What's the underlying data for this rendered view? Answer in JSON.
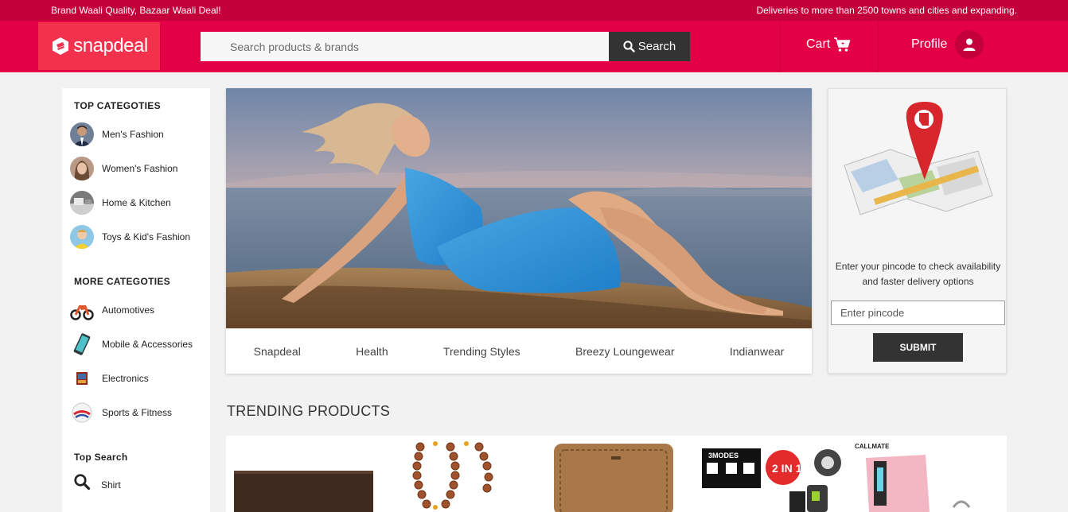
{
  "top_strip": {
    "left_text": "Brand Waali Quality, Bazaar Waali Deal!",
    "right_text": "Deliveries to more than 2500 towns and cities and expanding."
  },
  "header": {
    "logo_text": "snapdeal",
    "search_placeholder": "Search products & brands",
    "search_button": "Search",
    "cart_label": "Cart",
    "profile_label": "Profile"
  },
  "sidebar": {
    "top_heading": "TOP CATEGOTIES",
    "top_items": [
      {
        "label": "Men's Fashion",
        "icon": "mens-fashion-thumb"
      },
      {
        "label": "Women's Fashion",
        "icon": "womens-fashion-thumb"
      },
      {
        "label": "Home & Kitchen",
        "icon": "home-kitchen-thumb"
      },
      {
        "label": "Toys & Kid's Fashion",
        "icon": "toys-kids-thumb"
      }
    ],
    "more_heading": "MORE CATEGOTIES",
    "more_items": [
      {
        "label": "Automotives",
        "icon": "motorbike-icon"
      },
      {
        "label": "Mobile & Accessories",
        "icon": "mobile-icon"
      },
      {
        "label": "Electronics",
        "icon": "electronics-icon"
      },
      {
        "label": "Sports & Fitness",
        "icon": "sports-ball-icon"
      }
    ],
    "search_heading": "Top Search",
    "search_items": [
      {
        "label": "Shirt",
        "icon": "search-icon"
      }
    ]
  },
  "banner": {
    "tabs": [
      "Snapdeal",
      "Health",
      "Trending Styles",
      "Breezy Loungewear",
      "Indianwear"
    ]
  },
  "pincode": {
    "text": "Enter your pincode to check availability and faster delivery options",
    "placeholder": "Enter pincode",
    "button": "SUBMIT"
  },
  "trending": {
    "title": "TRENDING PRODUCTS",
    "mode_badge": "3MODES",
    "combo_badge": "2 IN 1",
    "brand_badge": "CALLMATE"
  },
  "colors": {
    "brand": "#e40046",
    "brand_dark": "#c4003a",
    "button_dark": "#333333"
  }
}
